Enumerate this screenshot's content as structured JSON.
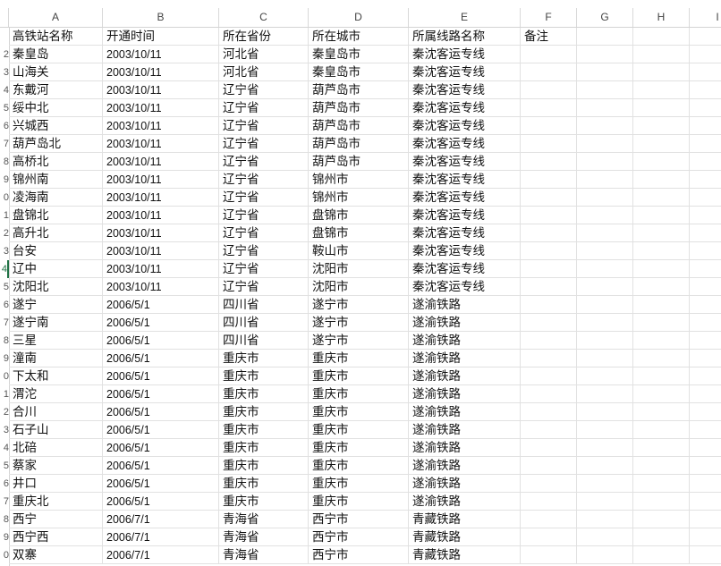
{
  "columns": [
    "A",
    "B",
    "C",
    "D",
    "E",
    "F",
    "G",
    "H",
    "I"
  ],
  "header_row": {
    "row_number": "",
    "cells": [
      "高铁站名称",
      "开通时间",
      "所在省份",
      "所在城市",
      "所属线路名称",
      "备注",
      "",
      "",
      ""
    ]
  },
  "rows": [
    {
      "row_number": "2",
      "cells": [
        "秦皇岛",
        "2003/10/11",
        "河北省",
        "秦皇岛市",
        "秦沈客运专线"
      ]
    },
    {
      "row_number": "3",
      "cells": [
        "山海关",
        "2003/10/11",
        "河北省",
        "秦皇岛市",
        "秦沈客运专线"
      ]
    },
    {
      "row_number": "4",
      "cells": [
        "东戴河",
        "2003/10/11",
        "辽宁省",
        "葫芦岛市",
        "秦沈客运专线"
      ]
    },
    {
      "row_number": "5",
      "cells": [
        "绥中北",
        "2003/10/11",
        "辽宁省",
        "葫芦岛市",
        "秦沈客运专线"
      ]
    },
    {
      "row_number": "6",
      "cells": [
        "兴城西",
        "2003/10/11",
        "辽宁省",
        "葫芦岛市",
        "秦沈客运专线"
      ]
    },
    {
      "row_number": "7",
      "cells": [
        "葫芦岛北",
        "2003/10/11",
        "辽宁省",
        "葫芦岛市",
        "秦沈客运专线"
      ]
    },
    {
      "row_number": "8",
      "cells": [
        "高桥北",
        "2003/10/11",
        "辽宁省",
        "葫芦岛市",
        "秦沈客运专线"
      ]
    },
    {
      "row_number": "9",
      "cells": [
        "锦州南",
        "2003/10/11",
        "辽宁省",
        "锦州市",
        "秦沈客运专线"
      ]
    },
    {
      "row_number": "0",
      "cells": [
        "凌海南",
        "2003/10/11",
        "辽宁省",
        "锦州市",
        "秦沈客运专线"
      ]
    },
    {
      "row_number": "1",
      "cells": [
        "盘锦北",
        "2003/10/11",
        "辽宁省",
        "盘锦市",
        "秦沈客运专线"
      ]
    },
    {
      "row_number": "2",
      "cells": [
        "高升北",
        "2003/10/11",
        "辽宁省",
        "盘锦市",
        "秦沈客运专线"
      ]
    },
    {
      "row_number": "3",
      "cells": [
        "台安",
        "2003/10/11",
        "辽宁省",
        "鞍山市",
        "秦沈客运专线"
      ]
    },
    {
      "row_number": "4",
      "cells": [
        "辽中",
        "2003/10/11",
        "辽宁省",
        "沈阳市",
        "秦沈客运专线"
      ]
    },
    {
      "row_number": "5",
      "cells": [
        "沈阳北",
        "2003/10/11",
        "辽宁省",
        "沈阳市",
        "秦沈客运专线"
      ]
    },
    {
      "row_number": "6",
      "cells": [
        "遂宁",
        "2006/5/1",
        "四川省",
        "遂宁市",
        "遂渝铁路"
      ]
    },
    {
      "row_number": "7",
      "cells": [
        "遂宁南",
        "2006/5/1",
        "四川省",
        "遂宁市",
        "遂渝铁路"
      ]
    },
    {
      "row_number": "8",
      "cells": [
        "三星",
        "2006/5/1",
        "四川省",
        "遂宁市",
        "遂渝铁路"
      ]
    },
    {
      "row_number": "9",
      "cells": [
        "潼南",
        "2006/5/1",
        "重庆市",
        "重庆市",
        "遂渝铁路"
      ]
    },
    {
      "row_number": "0",
      "cells": [
        "下太和",
        "2006/5/1",
        "重庆市",
        "重庆市",
        "遂渝铁路"
      ]
    },
    {
      "row_number": "1",
      "cells": [
        "渭沱",
        "2006/5/1",
        "重庆市",
        "重庆市",
        "遂渝铁路"
      ]
    },
    {
      "row_number": "2",
      "cells": [
        "合川",
        "2006/5/1",
        "重庆市",
        "重庆市",
        "遂渝铁路"
      ]
    },
    {
      "row_number": "3",
      "cells": [
        "石子山",
        "2006/5/1",
        "重庆市",
        "重庆市",
        "遂渝铁路"
      ]
    },
    {
      "row_number": "4",
      "cells": [
        "北碚",
        "2006/5/1",
        "重庆市",
        "重庆市",
        "遂渝铁路"
      ]
    },
    {
      "row_number": "5",
      "cells": [
        "蔡家",
        "2006/5/1",
        "重庆市",
        "重庆市",
        "遂渝铁路"
      ]
    },
    {
      "row_number": "6",
      "cells": [
        "井口",
        "2006/5/1",
        "重庆市",
        "重庆市",
        "遂渝铁路"
      ]
    },
    {
      "row_number": "7",
      "cells": [
        "重庆北",
        "2006/5/1",
        "重庆市",
        "重庆市",
        "遂渝铁路"
      ]
    },
    {
      "row_number": "8",
      "cells": [
        "西宁",
        "2006/7/1",
        "青海省",
        "西宁市",
        "青藏铁路"
      ]
    },
    {
      "row_number": "9",
      "cells": [
        "西宁西",
        "2006/7/1",
        "青海省",
        "西宁市",
        "青藏铁路"
      ]
    },
    {
      "row_number": "0",
      "cells": [
        "双寨",
        "2006/7/1",
        "青海省",
        "西宁市",
        "青藏铁路"
      ]
    }
  ],
  "active_row_index": 12,
  "accent_color": "#217346"
}
